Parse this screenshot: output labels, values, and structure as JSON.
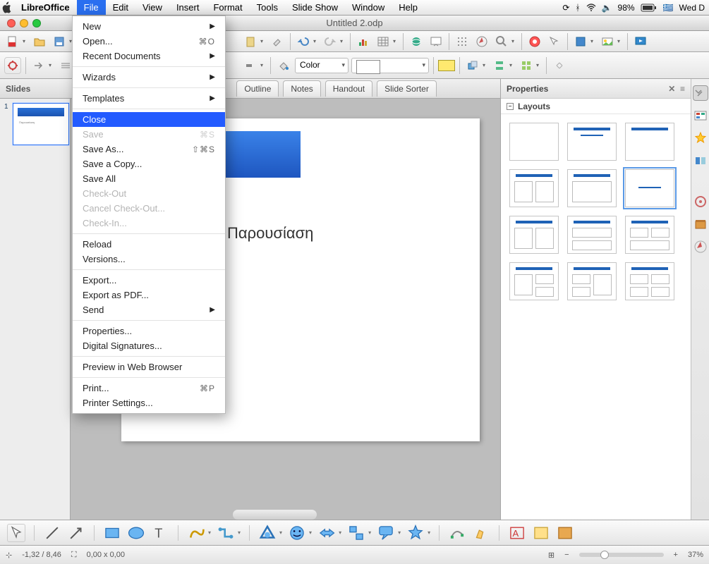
{
  "menubar": {
    "apple": "",
    "app": "LibreOffice",
    "items": [
      "File",
      "Edit",
      "View",
      "Insert",
      "Format",
      "Tools",
      "Slide Show",
      "Window",
      "Help"
    ],
    "active": "File",
    "right": {
      "battery": "98%",
      "clock": "Wed D",
      "flag": "🇬🇷"
    }
  },
  "window": {
    "title": "Untitled 2.odp"
  },
  "toolbar2": {
    "combo_label": "Color"
  },
  "viewtabs": {
    "panel_label": "Slides",
    "tabs": [
      "Outline",
      "Notes",
      "Handout",
      "Slide Sorter"
    ]
  },
  "slides": {
    "num1": "1",
    "thumb_text": "Παρουσίαση"
  },
  "slide_content": {
    "text": "Παρουσίαση"
  },
  "properties": {
    "title": "Properties",
    "section": "Layouts"
  },
  "status": {
    "coord": "-1,32 / 8,46",
    "size": "0,00 x 0,00",
    "zoom": "37%"
  },
  "file_menu": {
    "new": "New",
    "open": "Open...",
    "open_sc": "⌘O",
    "recent": "Recent Documents",
    "wizards": "Wizards",
    "templates": "Templates",
    "close": "Close",
    "save": "Save",
    "save_sc": "⌘S",
    "saveas": "Save As...",
    "saveas_sc": "⇧⌘S",
    "savecopy": "Save a Copy...",
    "saveall": "Save All",
    "checkout": "Check-Out",
    "cancelco": "Cancel Check-Out...",
    "checkin": "Check-In...",
    "reload": "Reload",
    "versions": "Versions...",
    "export": "Export...",
    "exportpdf": "Export as PDF...",
    "send": "Send",
    "properties": "Properties...",
    "digsig": "Digital Signatures...",
    "preview": "Preview in Web Browser",
    "print": "Print...",
    "print_sc": "⌘P",
    "printerset": "Printer Settings..."
  }
}
